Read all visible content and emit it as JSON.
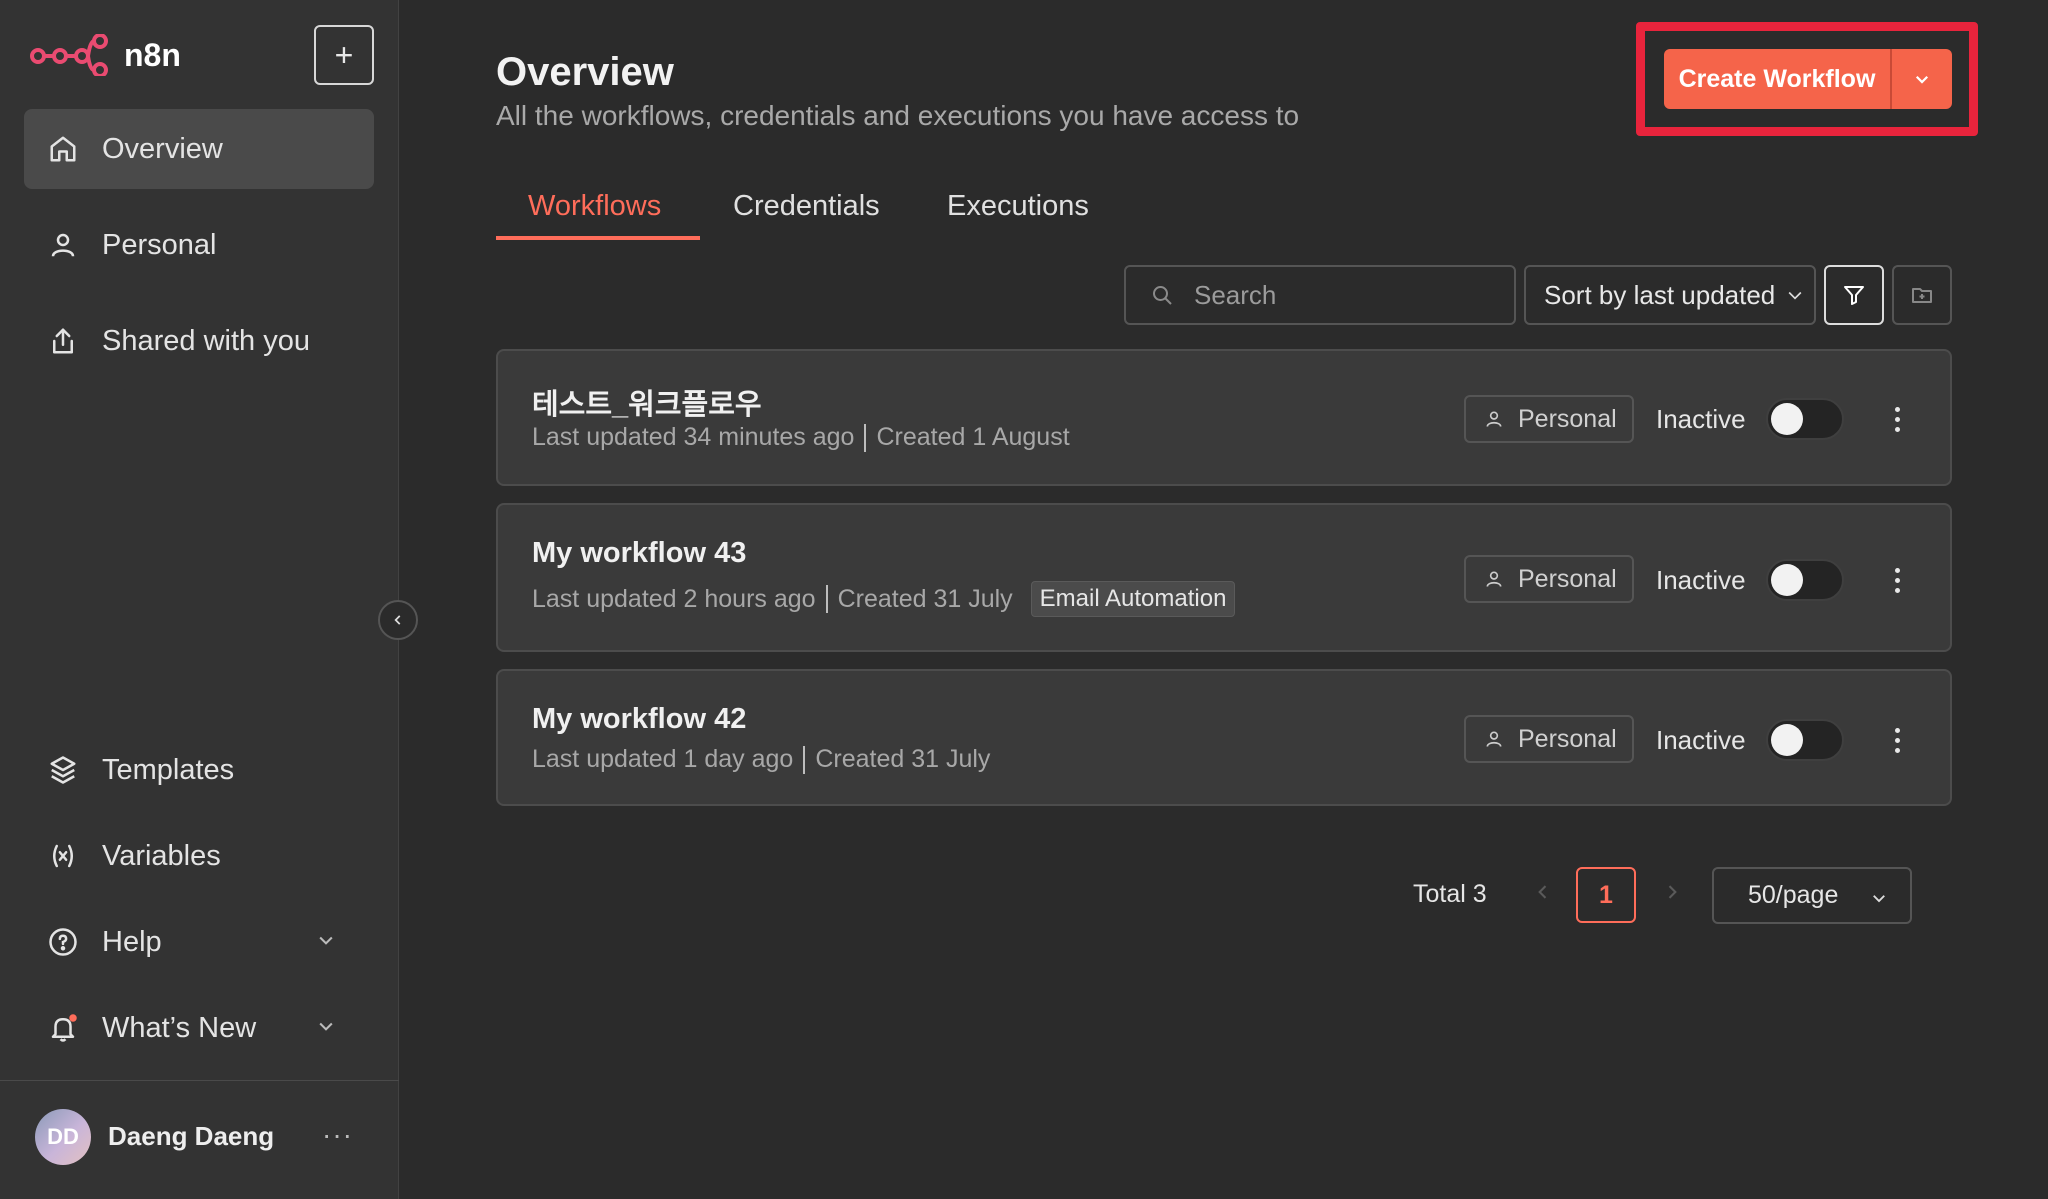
{
  "app": {
    "name": "n8n",
    "brand_color": "#ff6d5a"
  },
  "sidebar": {
    "new_button": "+",
    "nav_top": [
      {
        "label": "Overview",
        "icon": "home-icon",
        "active": true
      },
      {
        "label": "Personal",
        "icon": "user-icon",
        "active": false
      },
      {
        "label": "Shared with you",
        "icon": "share-icon",
        "active": false
      }
    ],
    "nav_bottom": [
      {
        "label": "Templates",
        "icon": "templates-icon"
      },
      {
        "label": "Variables",
        "icon": "variables-icon"
      },
      {
        "label": "Help",
        "icon": "help-icon"
      },
      {
        "label": "What’s New",
        "icon": "bell-icon"
      }
    ],
    "user": {
      "initials": "DD",
      "name": "Daeng Daeng",
      "more": "···"
    }
  },
  "header": {
    "title": "Overview",
    "subtitle": "All the workflows, credentials and executions you have access to",
    "create_button": "Create Workflow"
  },
  "tabs": [
    {
      "label": "Workflows",
      "active": true
    },
    {
      "label": "Credentials",
      "active": false
    },
    {
      "label": "Executions",
      "active": false
    }
  ],
  "toolbar": {
    "search_placeholder": "Search",
    "sort_label": "Sort by last updated"
  },
  "workflows": [
    {
      "name": "테스트_워크플로우",
      "updated": "Last updated 34 minutes ago",
      "created": "Created 1 August",
      "tag": "",
      "owner": "Personal",
      "status": "Inactive"
    },
    {
      "name": "My workflow 43",
      "updated": "Last updated 2 hours ago",
      "created": "Created 31 July",
      "tag": "Email Automation",
      "owner": "Personal",
      "status": "Inactive"
    },
    {
      "name": "My workflow 42",
      "updated": "Last updated 1 day ago",
      "created": "Created 31 July",
      "tag": "",
      "owner": "Personal",
      "status": "Inactive"
    }
  ],
  "pagination": {
    "total": "Total 3",
    "current_page": "1",
    "per_page": "50/page"
  },
  "colors": {
    "accent": "#ff6d5a",
    "highlight_box": "#e8243c",
    "create_button": "#f5644a"
  }
}
